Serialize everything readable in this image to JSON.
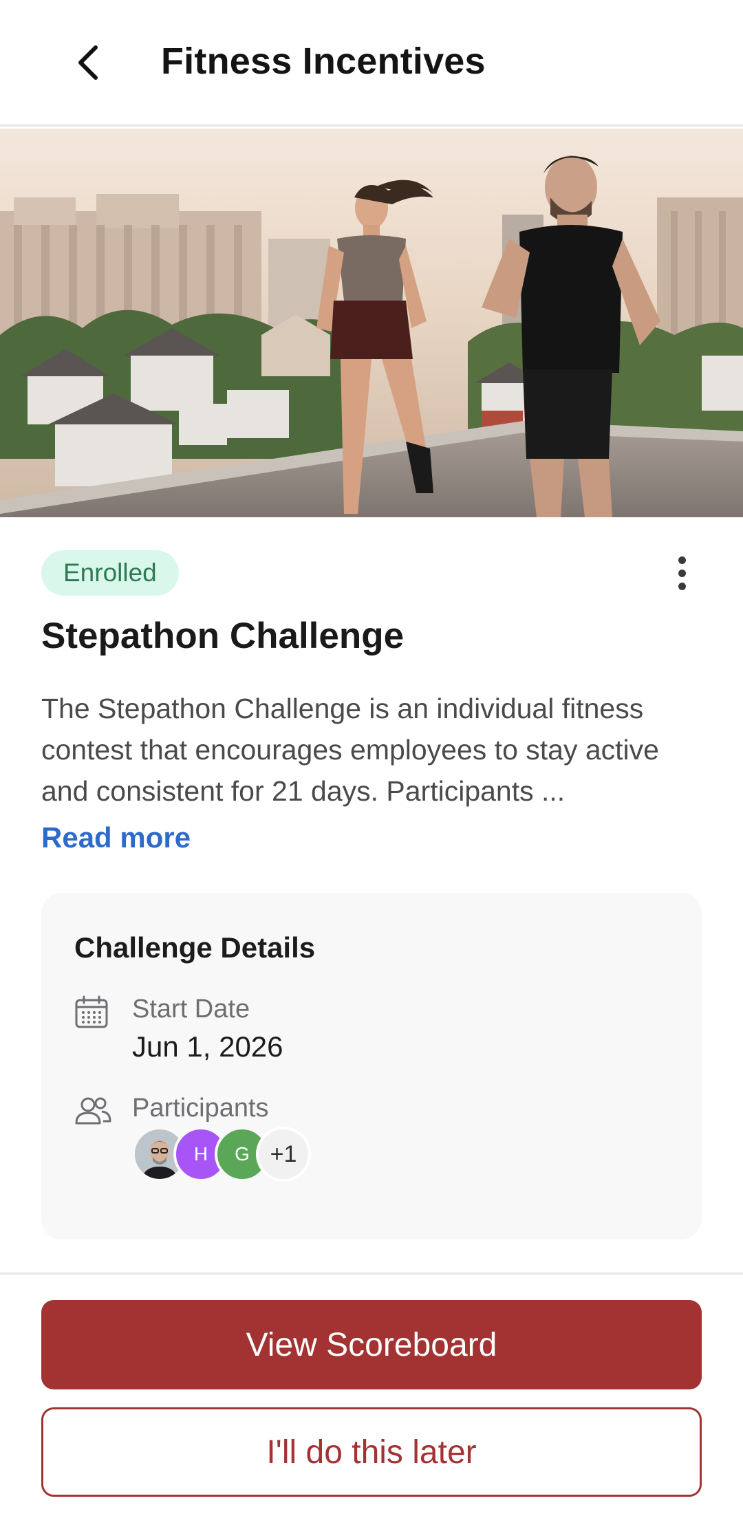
{
  "header": {
    "title": "Fitness Incentives",
    "back_icon": "chevron-left-icon"
  },
  "hero": {
    "image": "two runners jogging on a rooftop above a city at sunset"
  },
  "challenge": {
    "status_badge": "Enrolled",
    "title": "Stepathon Challenge",
    "description": "The Stepathon Challenge is an individual fitness contest that encourages employees to stay active and consistent for 21 days. Participants ...",
    "read_more": "Read more",
    "more_icon": "more-vertical-icon"
  },
  "details": {
    "heading": "Challenge Details",
    "start_date_label": "Start Date",
    "start_date_value": "Jun 1, 2026",
    "participants_label": "Participants",
    "participants": [
      {
        "type": "photo"
      },
      {
        "initial": "H",
        "color": "#a855f7"
      },
      {
        "initial": "G",
        "color": "#5aa857"
      }
    ],
    "more_count": "+1"
  },
  "actions": {
    "primary": "View Scoreboard",
    "secondary": "I'll do this later"
  },
  "colors": {
    "accent": "#a33333",
    "link": "#2d6bcb",
    "badge_bg": "#d9f7ea",
    "badge_text": "#2f7a55"
  }
}
